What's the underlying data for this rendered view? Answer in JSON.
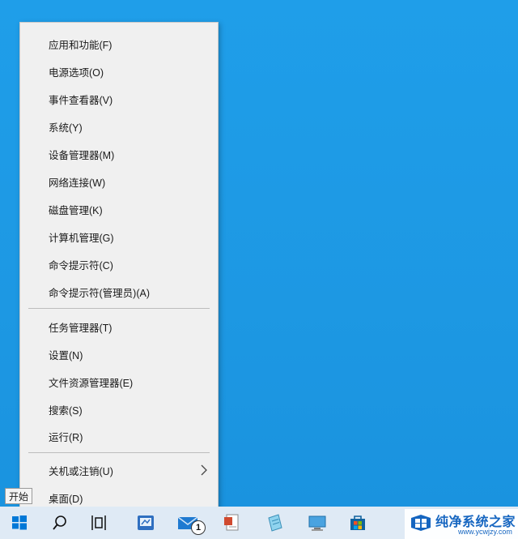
{
  "context_menu": {
    "items": [
      {
        "label": "应用和功能(F)"
      },
      {
        "label": "电源选项(O)"
      },
      {
        "label": "事件查看器(V)"
      },
      {
        "label": "系统(Y)"
      },
      {
        "label": "设备管理器(M)"
      },
      {
        "label": "网络连接(W)"
      },
      {
        "label": "磁盘管理(K)"
      },
      {
        "label": "计算机管理(G)"
      },
      {
        "label": "命令提示符(C)"
      },
      {
        "label": "命令提示符(管理员)(A)"
      },
      {
        "label": "任务管理器(T)"
      },
      {
        "label": "设置(N)"
      },
      {
        "label": "文件资源管理器(E)"
      },
      {
        "label": "搜索(S)"
      },
      {
        "label": "运行(R)"
      },
      {
        "label": "关机或注销(U)",
        "has_submenu": true
      },
      {
        "label": "桌面(D)"
      }
    ]
  },
  "tooltip": {
    "text": "开始"
  },
  "taskbar": {
    "icons": [
      "windows-start-icon",
      "search-icon",
      "task-view-icon",
      "app-icon",
      "mail-icon",
      "document-icon",
      "notepad-icon",
      "computer-icon",
      "store-icon"
    ],
    "badge_count": "1",
    "background": "#dfeaf5"
  },
  "watermark": {
    "title": "纯净系统之家",
    "url": "www.ycwjzy.com"
  },
  "colors": {
    "desktop": "#1d98e3",
    "menu_bg": "#f0f0f0",
    "accent": "#0078d7"
  }
}
